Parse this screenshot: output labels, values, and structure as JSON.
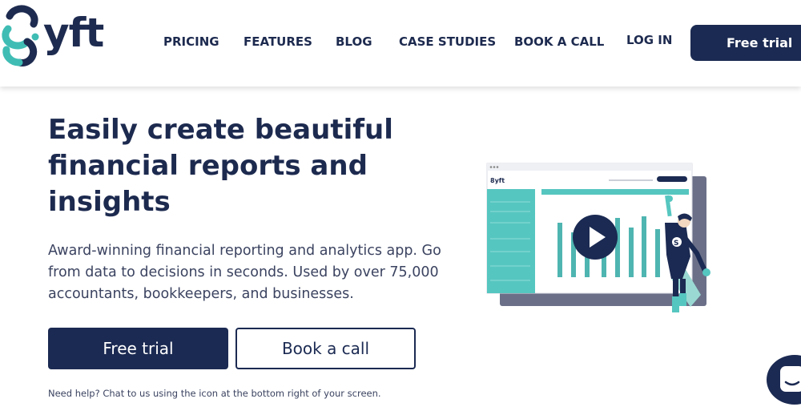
{
  "brand": {
    "name": "yft",
    "accent": "#3fbdb4",
    "navy": "#1b2a52"
  },
  "nav": {
    "items": [
      "PRICING",
      "FEATURES",
      "BLOG",
      "CASE STUDIES",
      "BOOK A CALL",
      "LOG IN"
    ],
    "cta": "Free trial"
  },
  "hero": {
    "headline": "Easily create beautiful financial reports and insights",
    "subtext": "Award-winning financial reporting and analytics app. Go from data to decisions in seconds. Used by over 75,000 accountants, bookkeepers, and businesses.",
    "primary_button": "Free trial",
    "secondary_button": "Book a call",
    "help_text": "Need help? Chat to us using the icon at the bottom right of your screen."
  },
  "illustration": {
    "app_logo": "8yft"
  },
  "icons": {
    "play": "play-icon",
    "chat": "chat-icon",
    "logo": "syft-logo-icon"
  }
}
